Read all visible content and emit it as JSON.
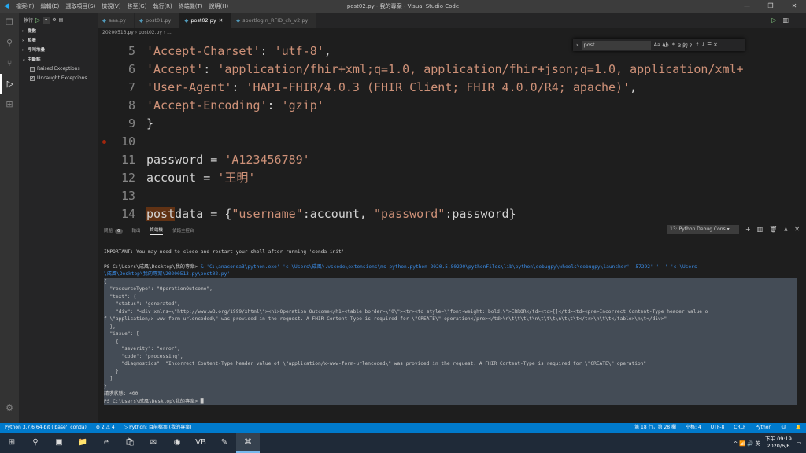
{
  "titlebar": {
    "menu": [
      "檔案(F)",
      "編輯(E)",
      "選取項目(S)",
      "檢視(V)",
      "移至(G)",
      "執行(R)",
      "終端機(T)",
      "說明(H)"
    ],
    "title": "post02.py - 我的專案 - Visual Studio Code",
    "buttons": [
      "—",
      "❐",
      "✕"
    ]
  },
  "sidebar": {
    "run_label": "執行",
    "sections": [
      "變數",
      "監看",
      "呼叫堆疊",
      "中斷點"
    ],
    "breakpoints": [
      {
        "label": "Raised Exceptions",
        "checked": false
      },
      {
        "label": "Uncaught Exceptions",
        "checked": true
      }
    ]
  },
  "tabs": [
    "aaa.py",
    "post01.py",
    "post02.py",
    "sportlogin_RFID_ch_v2.py"
  ],
  "breadcrumb": "20200513.py  ›  post02.py  ›  ...",
  "editor": {
    "lines": [
      {
        "n": "5",
        "key": "'Accept-Charset'",
        "val": "'utf-8'",
        "tail": ","
      },
      {
        "n": "6",
        "key": "'Accept'",
        "val": "'application/fhir+xml;q=1.0, application/fhir+json;q=1.0, application/xml+fh",
        "tail": ""
      },
      {
        "n": "7",
        "key": "'User-Agent'",
        "val": "'HAPI-FHIR/4.0.3 (FHIR Client; FHIR 4.0.0/R4; apache)'",
        "tail": ","
      },
      {
        "n": "8",
        "key": "'Accept-Encoding'",
        "val": "'gzip'",
        "tail": ""
      },
      {
        "n": "9",
        "plain": "}"
      },
      {
        "n": "10",
        "plain": ""
      },
      {
        "n": "11",
        "pre": "password = ",
        "val": "'A123456789'"
      },
      {
        "n": "12",
        "pre": "account = ",
        "val": "'王明'"
      },
      {
        "n": "13",
        "plain": ""
      },
      {
        "n": "14",
        "postdata": true
      }
    ],
    "postdata": {
      "kw": "post",
      "rest": "data = {",
      "k1": "\"username\"",
      "m1": ":account, ",
      "k2": "\"password\"",
      "m2": ":password}"
    }
  },
  "find": {
    "query": "post",
    "opts": "Aa  A͟b  .*",
    "result": "3 的 ?",
    "nav": "↑  ↓  ☰  ✕"
  },
  "panel": {
    "tabs": [
      "問題",
      "輸出",
      "終端機",
      "偵錯主控台"
    ],
    "problems_count": "6",
    "terminal_select": "13: Python Debug Cons",
    "actions": [
      "+",
      "▥",
      "🗑",
      "∧",
      "✕"
    ]
  },
  "terminal": {
    "important": "IMPORTANT: You may need to close and restart your shell after running 'conda init'.",
    "prompt": "PS C:\\Users\\成風\\Desktop\\我的專案>",
    "command1": " & 'C:\\anaconda3\\python.exe' 'c:\\Users\\成風\\.vscode\\extensions\\ms-python.python-2020.5.80290\\pythonFiles\\lib\\python\\debugpy\\wheels\\debugpy\\launcher' '57292' '--' 'c:\\Users",
    "command2": "\\成風\\Desktop\\我的專案\\20200513.py\\post02.py'",
    "json_lines": [
      "{",
      "  \"resourceType\": \"OperationOutcome\",",
      "  \"text\": {",
      "    \"status\": \"generated\",",
      "    \"div\": \"<div xmlns=\\\"http://www.w3.org/1999/xhtml\\\"><h1>Operation Outcome</h1><table border=\\\"0\\\"><tr><td style=\\\"font-weight: bold;\\\">ERROR</td><td>[]</td><td><pre>Incorrect Content-Type header value o",
      "f \\\"application/x-www-form-urlencoded\\\" was provided in the request. A FHIR Content-Type is required for \\\"CREATE\\\" operation</pre></td>\\n\\t\\t\\t\\t\\n\\t\\t\\t\\n\\t\\t\\t</tr>\\n\\t\\t</table>\\n\\t</div>\"",
      "  },",
      "  \"issue\": [",
      "    {",
      "      \"severity\": \"error\",",
      "      \"code\": \"processing\",",
      "      \"diagnostics\": \"Incorrect Content-Type header value of \\\"application/x-www-form-urlencoded\\\" was provided in the request. A FHIR Content-Type is required for \\\"CREATE\\\" operation\"",
      "    }",
      "  ]",
      "}"
    ],
    "status_line": "請求狀態: 400",
    "final_prompt": "PS C:\\Users\\成風\\Desktop\\我的專案> █"
  },
  "statusbar": {
    "left": [
      "Python 3.7.6 64-bit ('base': conda)",
      "⊗ 2 ⚠ 4",
      "▷ Python: 目前檔案 (我的專案)"
    ],
    "right": [
      "第 18 行，第 28 欄",
      "空格: 4",
      "UTF-8",
      "CRLF",
      "Python",
      "☺",
      "🔔"
    ]
  },
  "taskbar": {
    "apps": [
      "⊞",
      "⚲",
      "▣",
      "📁",
      "e",
      "🛍",
      "✉",
      "◉",
      "VB",
      "✎",
      "⌘"
    ],
    "tray": "^  📶  🔊  英",
    "time": "下午 09:19",
    "date": "2020/6/6"
  },
  "colors": {
    "accent": "#007acc",
    "string": "#ce9178",
    "breakpoint": "#a1260d"
  }
}
